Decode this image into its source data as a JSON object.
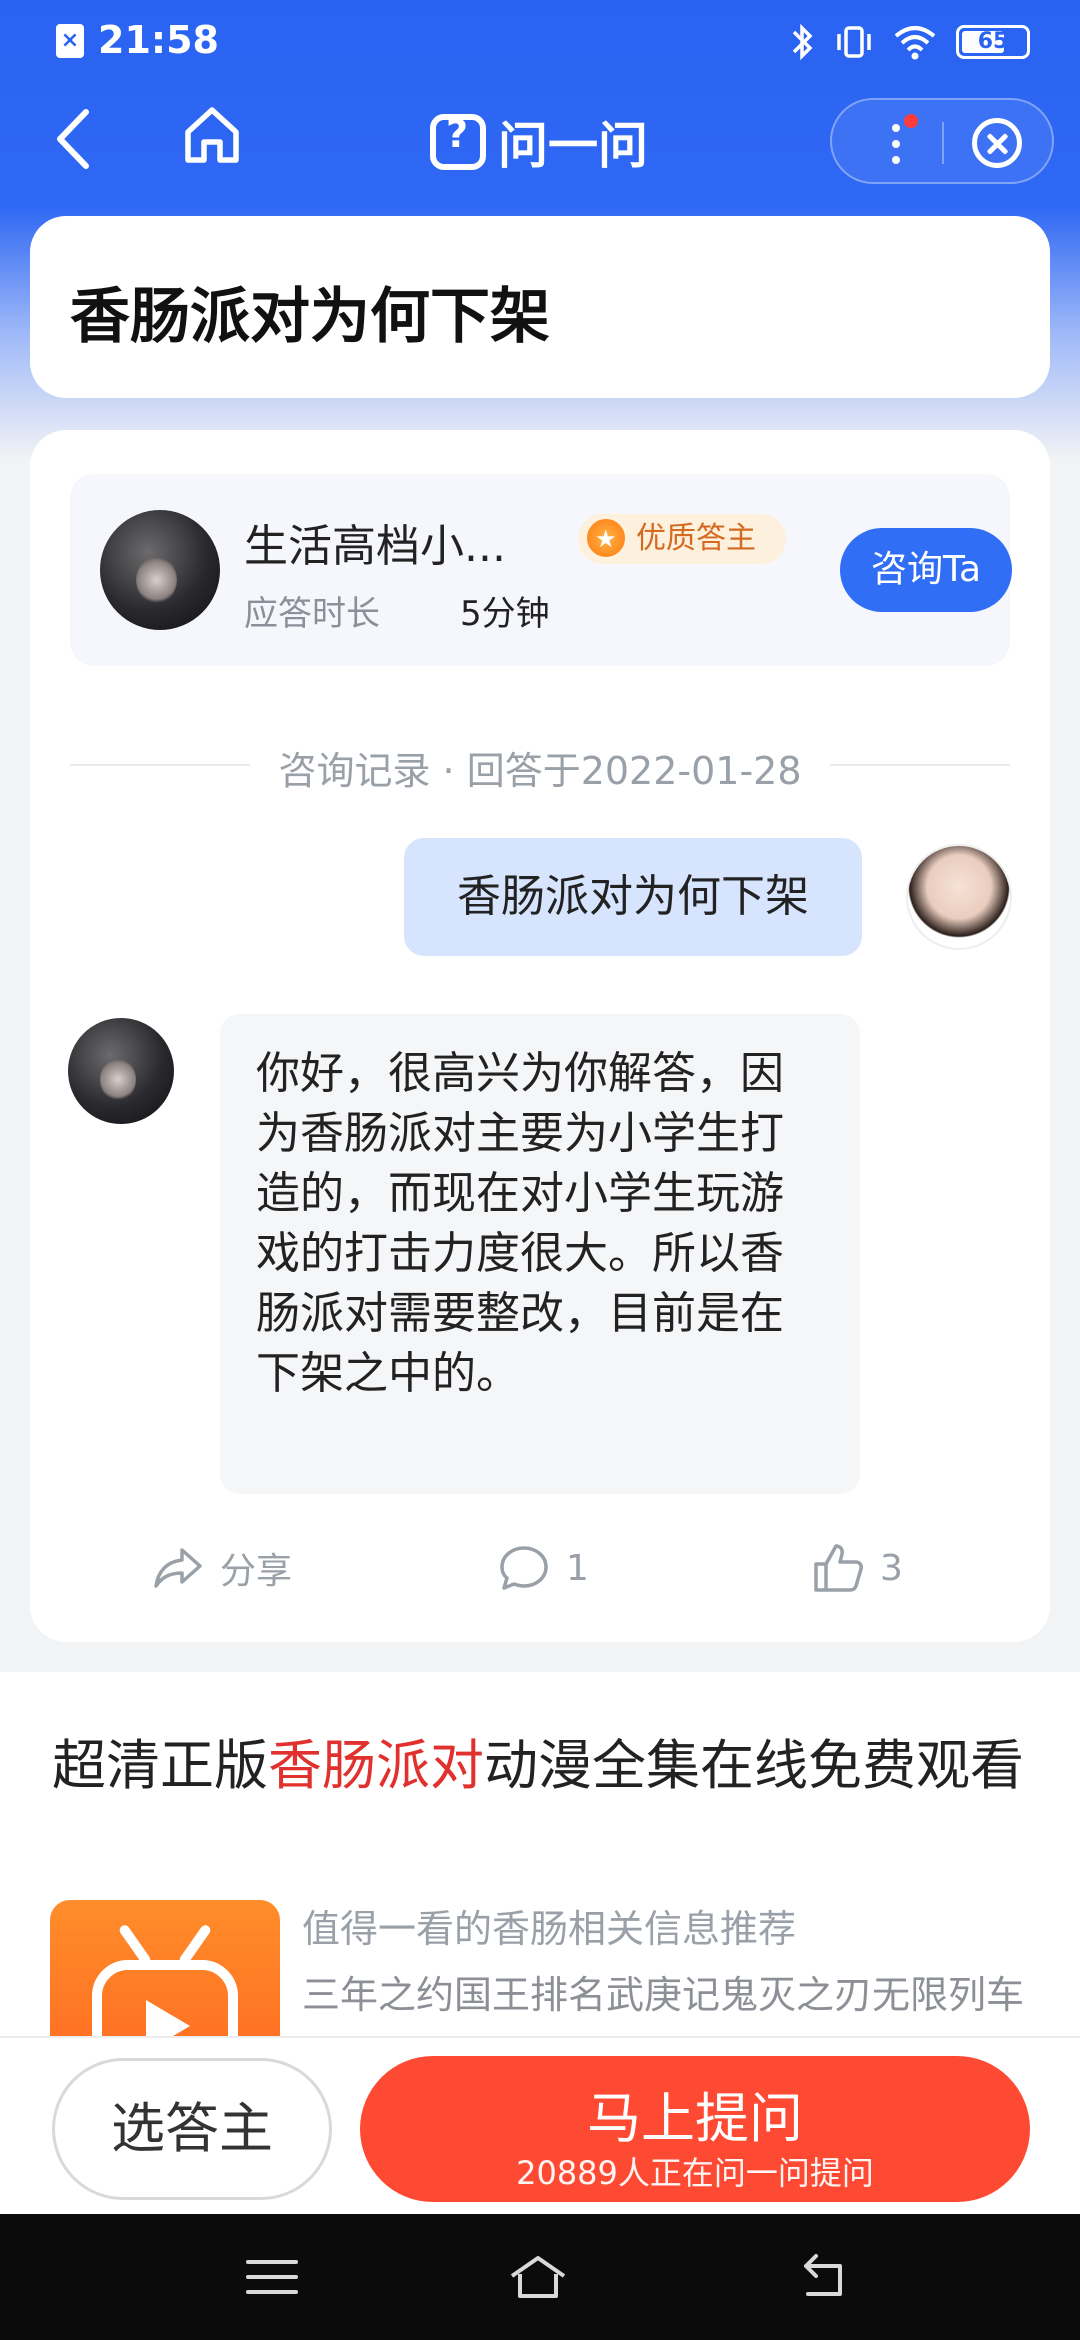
{
  "status_bar": {
    "time": "21:58",
    "battery": "65"
  },
  "nav": {
    "title": "问一问"
  },
  "question": {
    "title": "香肠派对为何下架"
  },
  "answerer": {
    "name": "生活高档小...",
    "badge": "优质答主",
    "duration_label": "应答时长",
    "duration_value": "5分钟",
    "consult_label": "咨询Ta"
  },
  "record": {
    "text": "咨询记录 · 回答于2022-01-28"
  },
  "conversation": {
    "user_message": "香肠派对为何下架",
    "answer": "你好，很高兴为你解答，因为香肠派对主要为小学生打造的，而现在对小学生玩游戏的打击力度很大。所以香肠派对需要整改，目前是在下架之中的。"
  },
  "actions": {
    "share_label": "分享",
    "comment_count": "1",
    "like_count": "3"
  },
  "recommendation": {
    "title_prefix": "超清正版",
    "title_highlight": "香肠派对",
    "title_suffix": "动漫全集在线免费观看",
    "subtitle": "值得一看的香肠相关信息推荐",
    "description": "三年之约国王排名武庚记鬼灭之刃无限列车版等热门动漫应有尽有免费影视"
  },
  "bottom_bar": {
    "pick_label": "选答主",
    "ask_label": "马上提问",
    "ask_sub": "20889人正在问一问提问"
  },
  "colors": {
    "brand_blue": "#2f6ef5",
    "ask_red": "#ff4a33",
    "highlight_red": "#e0312e"
  }
}
